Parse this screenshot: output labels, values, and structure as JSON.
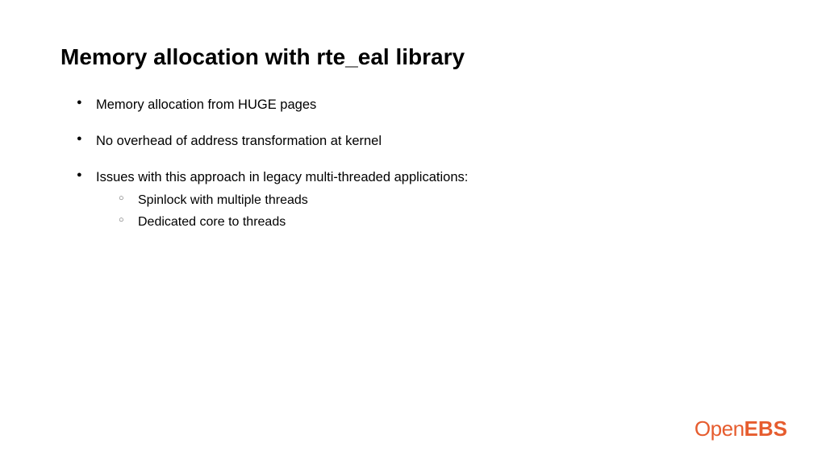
{
  "slide": {
    "title": "Memory allocation with rte_eal library",
    "bullets": [
      {
        "text": "Memory allocation from HUGE pages"
      },
      {
        "text": "No overhead of address transformation at kernel"
      },
      {
        "text": "Issues with this approach in legacy multi-threaded applications:",
        "subitems": [
          "Spinlock with multiple threads",
          "Dedicated core to threads"
        ]
      }
    ]
  },
  "logo": {
    "part1": "Open",
    "part2": "EBS"
  }
}
